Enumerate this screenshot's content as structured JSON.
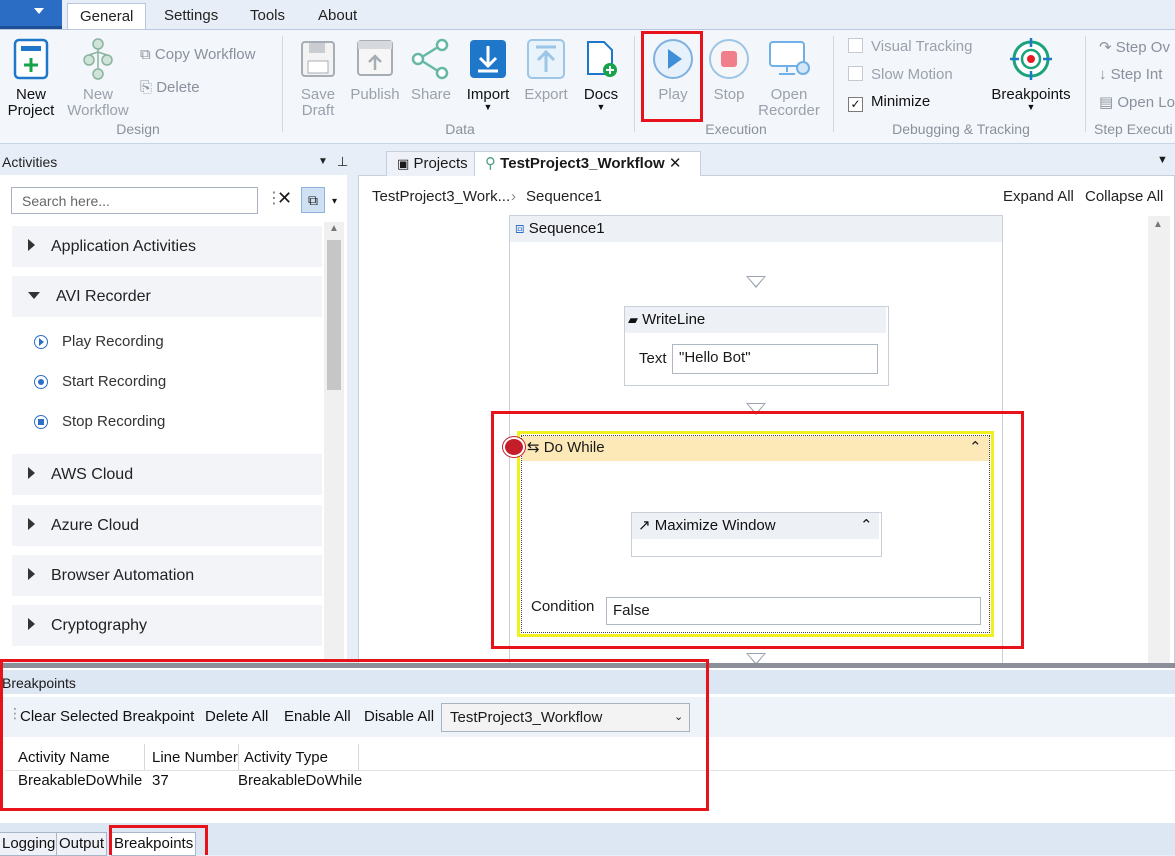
{
  "tabs": [
    "General",
    "Settings",
    "Tools",
    "About"
  ],
  "ribbon": {
    "design": {
      "new_project": "New Project",
      "new_workflow": "New Workflow",
      "copy_workflow": "Copy Workflow",
      "delete": "Delete",
      "group": "Design"
    },
    "data": {
      "save_draft": "Save Draft",
      "publish": "Publish",
      "share": "Share",
      "import": "Import",
      "export": "Export",
      "docs": "Docs",
      "group": "Data"
    },
    "execution": {
      "play": "Play",
      "stop": "Stop",
      "open_recorder": "Open Recorder",
      "group": "Execution"
    },
    "debugging": {
      "visual_tracking": "Visual Tracking",
      "slow_motion": "Slow Motion",
      "minimize": "Minimize",
      "minimize_checked": true,
      "breakpoints": "Breakpoints",
      "group": "Debugging & Tracking"
    },
    "step": {
      "step_over": "Step Ov",
      "step_into": "Step Int",
      "open_log": "Open Lo",
      "group": "Step Executi"
    }
  },
  "activities": {
    "header": "Activities",
    "search_placeholder": "Search here...",
    "categories": [
      {
        "label": "Application Activities"
      },
      {
        "label": "AVI Recorder",
        "items": [
          "Play Recording",
          "Start Recording",
          "Stop Recording"
        ]
      },
      {
        "label": "AWS Cloud"
      },
      {
        "label": "Azure Cloud"
      },
      {
        "label": "Browser Automation"
      },
      {
        "label": "Cryptography"
      }
    ]
  },
  "designer": {
    "tab_project": "Projects",
    "tab_workflow": "TestProject3_Workflow",
    "breadcrumb": [
      "TestProject3_Work...",
      "Sequence1"
    ],
    "expand_all": "Expand All",
    "collapse_all": "Collapse All",
    "sequence_title": "Sequence1",
    "writeline_title": "WriteLine",
    "writeline_label": "Text",
    "writeline_value": "\"Hello Bot\"",
    "dowhile_title": "Do While",
    "maximize_title": "Maximize Window",
    "condition_label": "Condition",
    "condition_value": "False"
  },
  "breakpoints": {
    "title": "Breakpoints",
    "clear_selected": "Clear Selected Breakpoint",
    "delete_all": "Delete All",
    "enable_all": "Enable All",
    "disable_all": "Disable All",
    "workflow_select": "TestProject3_Workflow",
    "columns": [
      "Activity Name",
      "Line Number",
      "Activity Type"
    ],
    "rows": [
      {
        "name": "BreakableDoWhile",
        "line": "37",
        "type": "BreakableDoWhile"
      }
    ]
  },
  "bottom_tabs": [
    "Logging",
    "Output",
    "Breakpoints"
  ],
  "colors": {
    "accent": "#2d6fc6",
    "highlight": "#e8121b",
    "selected_border": "#f2ef1f"
  }
}
